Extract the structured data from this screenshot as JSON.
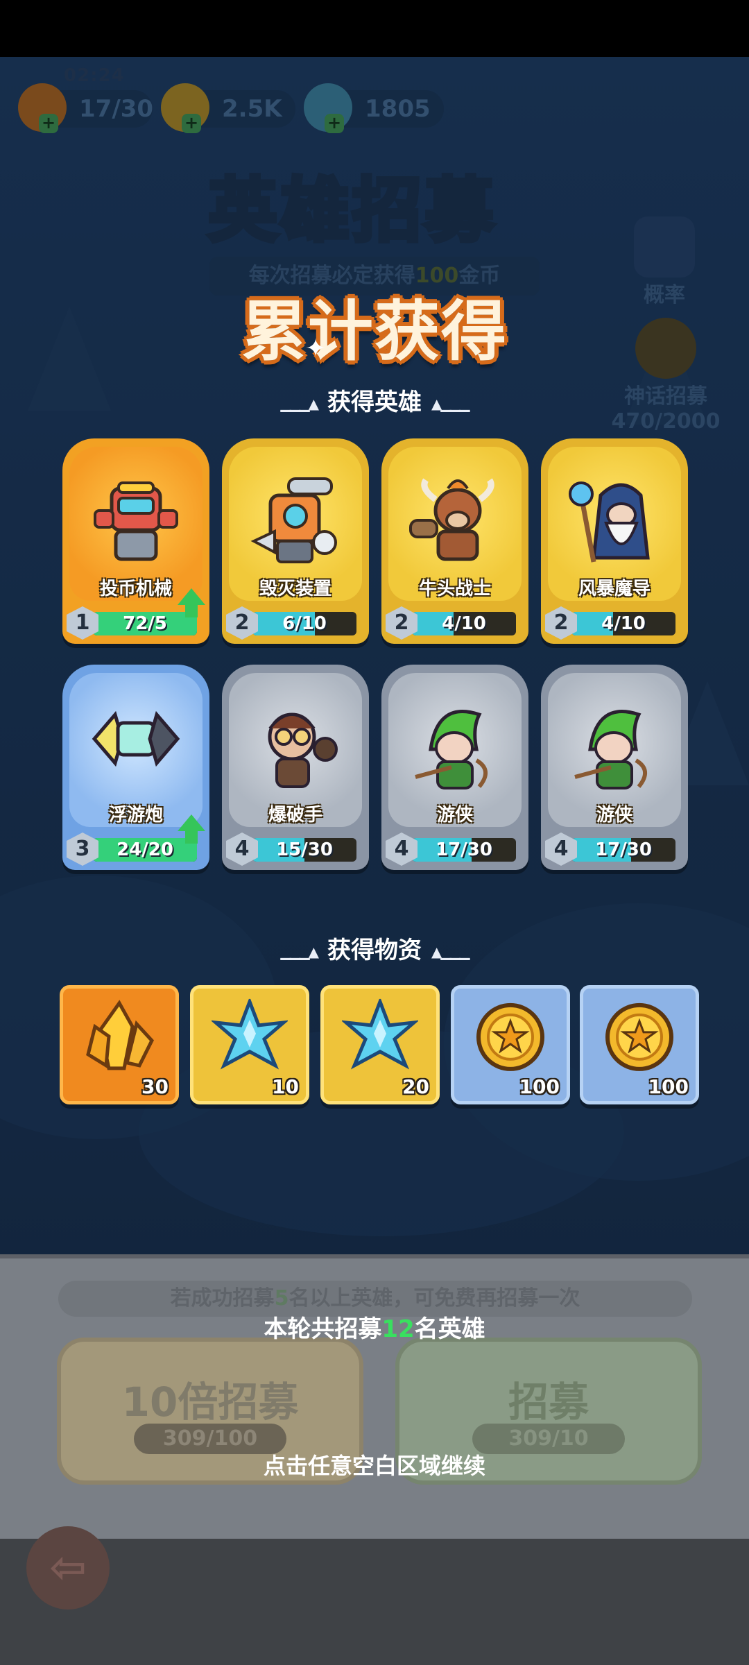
{
  "status": {
    "time": "02:24"
  },
  "resources": [
    {
      "name": "energy",
      "value": "17/30",
      "icon": "flame-icon"
    },
    {
      "name": "coin-plus",
      "value": "2.5K",
      "icon": "coin-icon"
    },
    {
      "name": "crystal",
      "value": "1805",
      "icon": "crystal-icon"
    }
  ],
  "background": {
    "title": "英雄招募",
    "subtitle_prefix": "每次招募必定获得",
    "subtitle_amount": "100",
    "subtitle_suffix": "金币",
    "probability_label": "概率",
    "myth_label": "神话招募",
    "myth_progress": "470/2000"
  },
  "popup": {
    "title": "累计获得",
    "heroes_header": "获得英雄",
    "items_header": "获得物资",
    "heroes": [
      {
        "name": "投币机械",
        "level": "1",
        "progress": "72/5",
        "fill": 1.0,
        "upgrade": true,
        "rarity": "orange"
      },
      {
        "name": "毁灭装置",
        "level": "2",
        "progress": "6/10",
        "fill": 0.6,
        "upgrade": false,
        "rarity": "gold"
      },
      {
        "name": "牛头战士",
        "level": "2",
        "progress": "4/10",
        "fill": 0.4,
        "upgrade": false,
        "rarity": "gold"
      },
      {
        "name": "风暴魔导",
        "level": "2",
        "progress": "4/10",
        "fill": 0.4,
        "upgrade": false,
        "rarity": "gold"
      },
      {
        "name": "浮游炮",
        "level": "3",
        "progress": "24/20",
        "fill": 1.0,
        "upgrade": true,
        "rarity": "blue"
      },
      {
        "name": "爆破手",
        "level": "4",
        "progress": "15/30",
        "fill": 0.5,
        "upgrade": false,
        "rarity": "gray"
      },
      {
        "name": "游侠",
        "level": "4",
        "progress": "17/30",
        "fill": 0.57,
        "upgrade": false,
        "rarity": "gray"
      },
      {
        "name": "游侠",
        "level": "4",
        "progress": "17/30",
        "fill": 0.57,
        "upgrade": false,
        "rarity": "gray"
      }
    ],
    "items": [
      {
        "icon": "gold-crystal-icon",
        "count": "30",
        "rarity": "orange-i"
      },
      {
        "icon": "ice-crystal-icon",
        "count": "10",
        "rarity": "gold-i"
      },
      {
        "icon": "ice-crystal-icon",
        "count": "20",
        "rarity": "gold-i"
      },
      {
        "icon": "gold-coin-icon",
        "count": "100",
        "rarity": "blue-i"
      },
      {
        "icon": "gold-coin-icon",
        "count": "100",
        "rarity": "blue-i"
      }
    ],
    "summary_prefix": "本轮共招募",
    "summary_count": "12",
    "summary_suffix": "名英雄",
    "continue_hint": "点击任意空白区域继续"
  },
  "bottom": {
    "hint_prefix": "若成功招募",
    "hint_count": "5",
    "hint_suffix": "名以上英雄，可免费再招募一次",
    "ten_pull_label": "10倍招募",
    "ten_pull_cost": "309/100",
    "single_pull_label": "招募",
    "single_pull_cost": "309/10"
  },
  "colors": {
    "accent_orange": "#d66b1a",
    "highlight_green": "#39e05f",
    "bar_cyan": "#3cc6d6"
  }
}
